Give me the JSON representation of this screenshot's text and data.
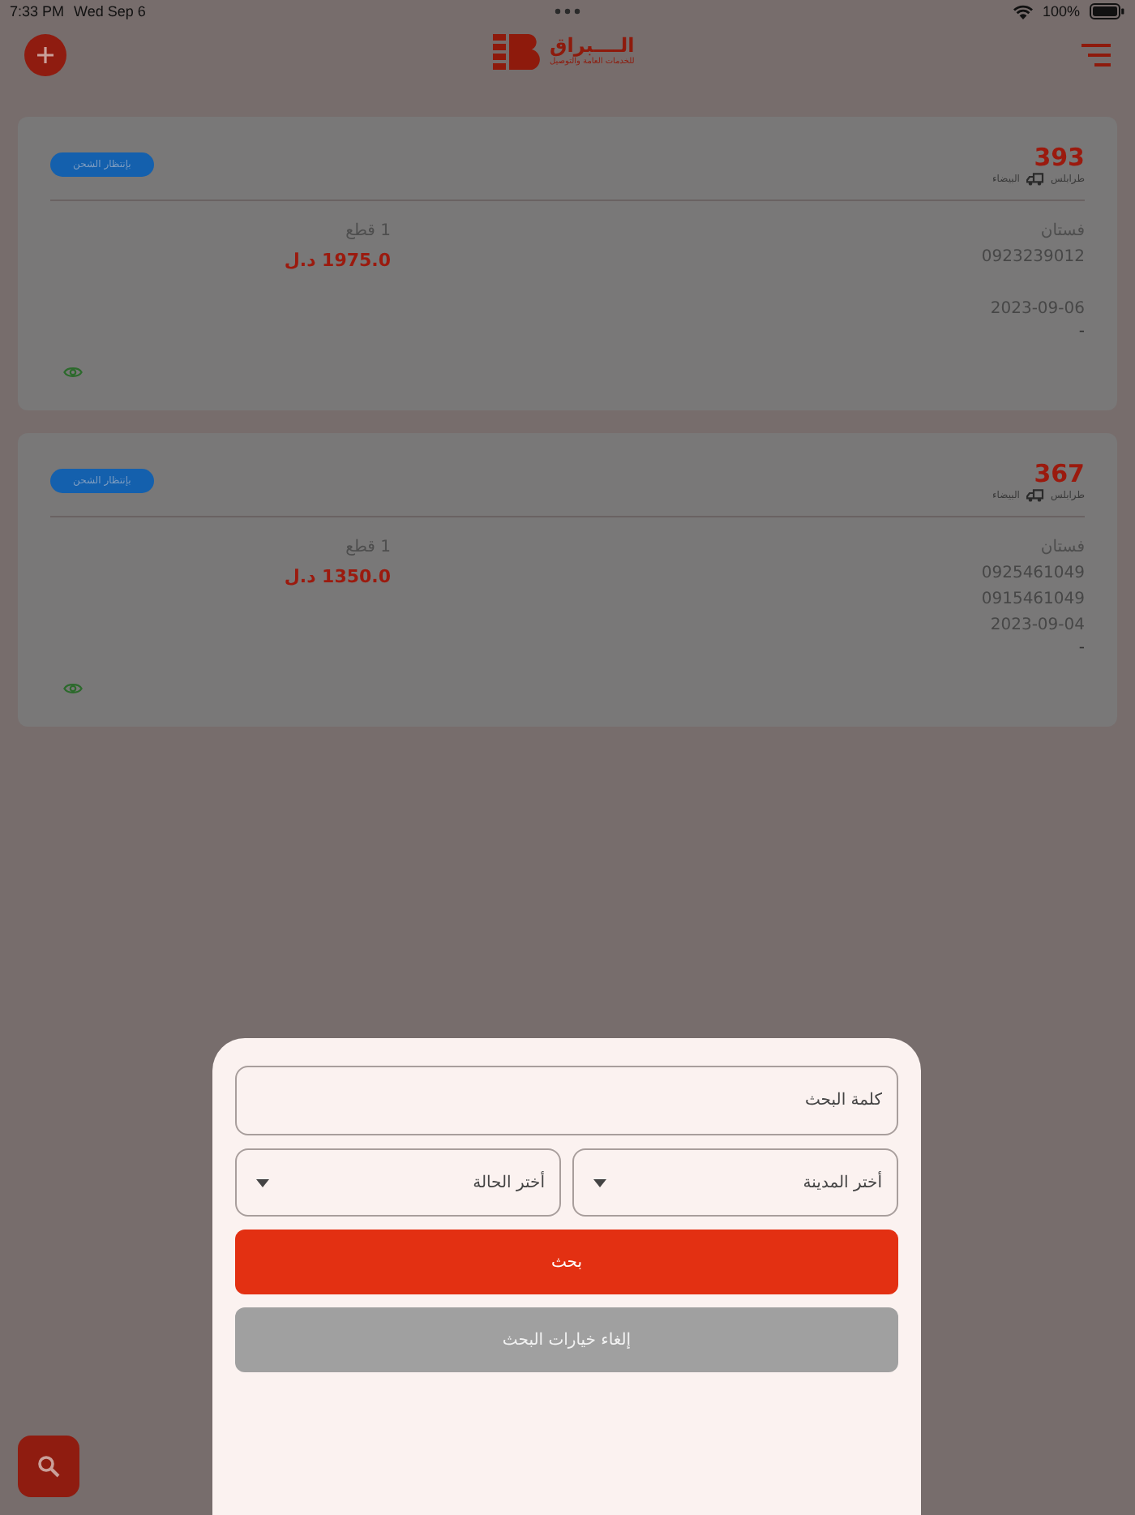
{
  "status_bar": {
    "time": "7:33 PM",
    "date": "Wed Sep 6",
    "battery": "100%"
  },
  "header": {
    "logo_title": "الــــبراق",
    "logo_subtitle": "للخدمات العامة والتوصيل"
  },
  "orders": [
    {
      "number": "393",
      "from": "طرابلس",
      "to": "البيضاء",
      "status": "بإنتظار الشحن",
      "item": "فستان",
      "phones": [
        "0923239012"
      ],
      "date": "2023-09-06",
      "note": "-",
      "quantity": "1 قطع",
      "price": "1975.0 د.ل"
    },
    {
      "number": "367",
      "from": "طرابلس",
      "to": "البيضاء",
      "status": "بإنتظار الشحن",
      "item": "فستان",
      "phones": [
        "0925461049",
        "0915461049"
      ],
      "date": "2023-09-04",
      "note": "-",
      "quantity": "1 قطع",
      "price": "1350.0 د.ل"
    }
  ],
  "search_sheet": {
    "keyword": {
      "placeholder": "كلمة البحث"
    },
    "city": {
      "placeholder": "أختر المدينة"
    },
    "state": {
      "placeholder": "أختر الحالة"
    },
    "search_button": "بحث",
    "cancel_button": "إلغاء خيارات البحث"
  }
}
